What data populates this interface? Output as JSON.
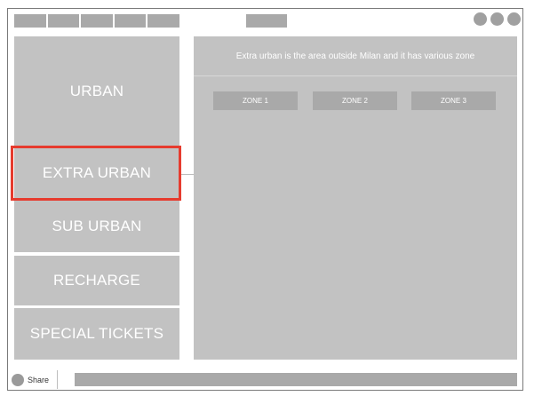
{
  "menu": {
    "items": [
      {
        "label": "URBAN"
      },
      {
        "label": "EXTRA URBAN",
        "selected": true
      },
      {
        "label": "SUB URBAN"
      },
      {
        "label": "RECHARGE"
      },
      {
        "label": "SPECIAL TICKETS"
      }
    ]
  },
  "content": {
    "description": "Extra urban is the area outside Milan and it has various zone",
    "zones": [
      "ZONE 1",
      "ZONE 2",
      "ZONE 3"
    ]
  },
  "footer": {
    "share_label": "Share",
    "share_icon": "share-icon"
  },
  "colors": {
    "placeholder_gray": "#c2c2c2",
    "dark_gray": "#a9a9a9",
    "selection_red": "#e63b2e"
  }
}
